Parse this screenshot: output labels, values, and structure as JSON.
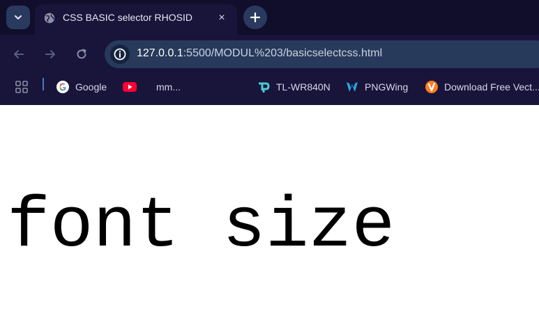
{
  "tab": {
    "title": "CSS BASIC selector RHOSID",
    "close_icon": "×"
  },
  "address_bar": {
    "host": "127.0.0.1",
    "rest": ":5500/MODUL%203/basicselectcss.html"
  },
  "bookmarks": [
    {
      "label": "Google",
      "icon": "google-icon"
    },
    {
      "label": "",
      "icon": "youtube-icon"
    },
    {
      "label": "mm...",
      "icon": ""
    },
    {
      "label": "TL-WR840N",
      "icon": "tplink-icon"
    },
    {
      "label": "PNGWing",
      "icon": "pngwing-icon"
    },
    {
      "label": "Download Free Vect...",
      "icon": "vecteezy-icon"
    }
  ],
  "page": {
    "text": "font size"
  },
  "colors": {
    "tabstrip": "#110e2c",
    "toolbar": "#18143a",
    "omnibox": "#283a5b",
    "accent": "#2a3a5e"
  }
}
